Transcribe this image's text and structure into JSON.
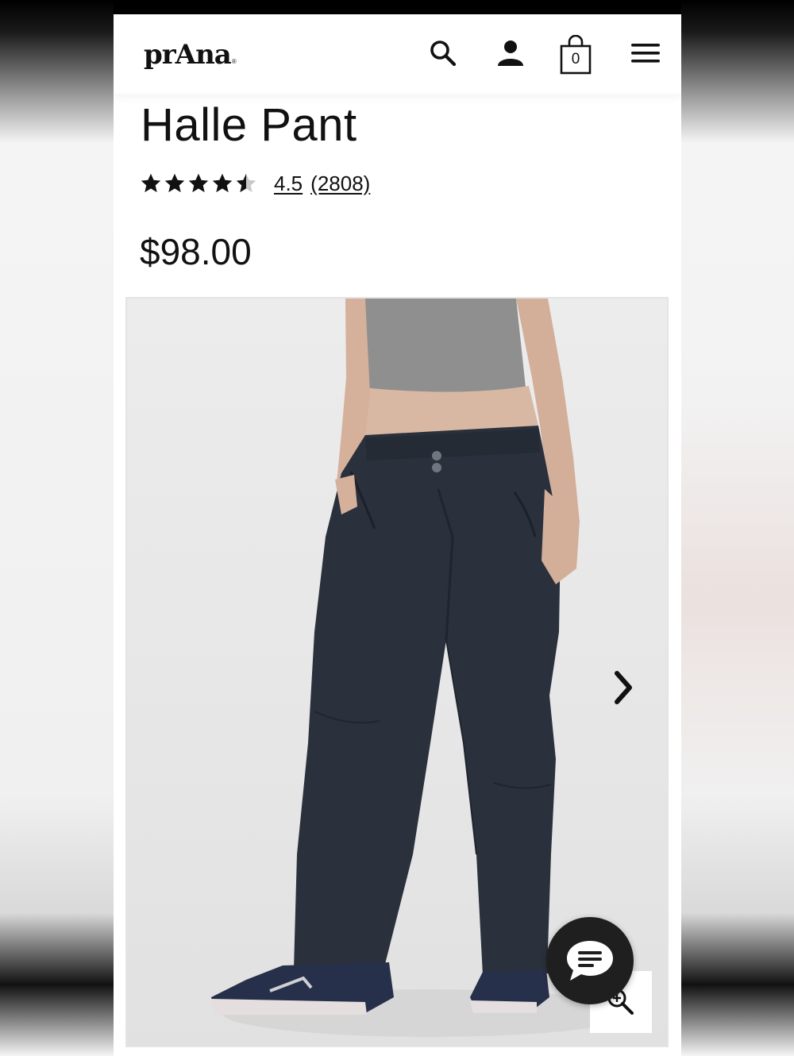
{
  "header": {
    "logo_text": "prAna",
    "logo_mark": "®",
    "icons": [
      "search-icon",
      "account-icon",
      "bag-icon",
      "menu-icon"
    ],
    "bag_count": "0"
  },
  "product": {
    "title": "Halle Pant",
    "rating": 4.5,
    "rating_text": "4.5",
    "review_count": "(2808)",
    "price": "$98.00"
  },
  "gallery": {
    "icons": [
      "chevron-right-icon",
      "zoom-icon"
    ]
  },
  "chat": {
    "icon": "chat-icon"
  },
  "colors": {
    "text": "#111111",
    "pants": "#2a313c",
    "top": "#8e8e8e",
    "chat_bg": "#1f1f1f"
  }
}
